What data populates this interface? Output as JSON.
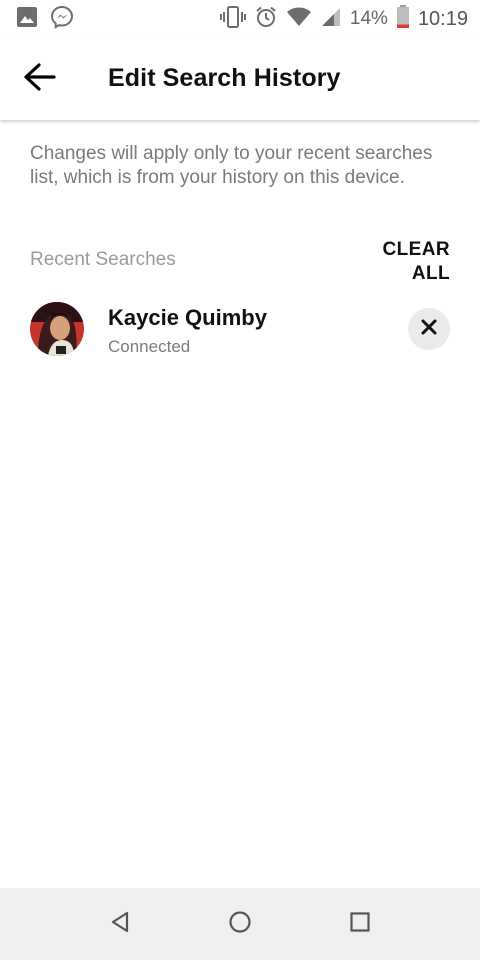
{
  "status_bar": {
    "left_icons": [
      "gallery-icon",
      "messenger-icon"
    ],
    "right_icons": [
      "vibrate-icon",
      "alarm-icon",
      "wifi-icon",
      "signal-icon",
      "battery-icon"
    ],
    "battery": "14%",
    "time": "10:19",
    "battery_level": 0.14,
    "battery_low_color": "#e53935"
  },
  "app_bar": {
    "back_icon": "arrow-back-icon",
    "title": "Edit Search History"
  },
  "description": "Changes will apply only to your recent searches list, which is from your history on this device.",
  "recent": {
    "header": "Recent Searches",
    "clear_line1": "CLEAR",
    "clear_line2": "ALL",
    "items": [
      {
        "name": "Kaycie Quimby",
        "subtitle": "Connected",
        "remove_icon": "close-icon"
      }
    ]
  },
  "nav_bar": {
    "icons": [
      "back-triangle-icon",
      "home-circle-icon",
      "recents-square-icon"
    ]
  }
}
